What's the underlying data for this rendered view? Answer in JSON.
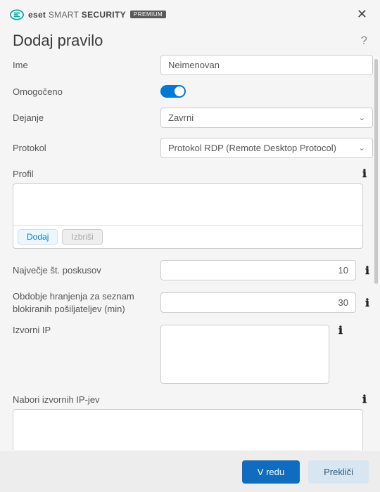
{
  "brand": {
    "eset": "eset",
    "product1": "SMART",
    "product2": "SECURITY",
    "badge": "PREMIUM"
  },
  "title": "Dodaj pravilo",
  "labels": {
    "name": "Ime",
    "enabled": "Omogočeno",
    "action": "Dejanje",
    "protocol": "Protokol",
    "profile": "Profil",
    "max_attempts": "Največje št. poskusov",
    "retention": "Obdobje hranjenja za seznam blokiranih pošiljateljev (min)",
    "source_ip": "Izvorni IP",
    "source_ip_sets": "Nabori izvornih IP-jev"
  },
  "values": {
    "name": "Neimenovan",
    "action": "Zavrni",
    "protocol": "Protokol RDP (Remote Desktop Protocol)",
    "max_attempts": "10",
    "retention": "30"
  },
  "buttons": {
    "add": "Dodaj",
    "delete": "Izbriši",
    "ok": "V redu",
    "cancel": "Prekliči"
  }
}
